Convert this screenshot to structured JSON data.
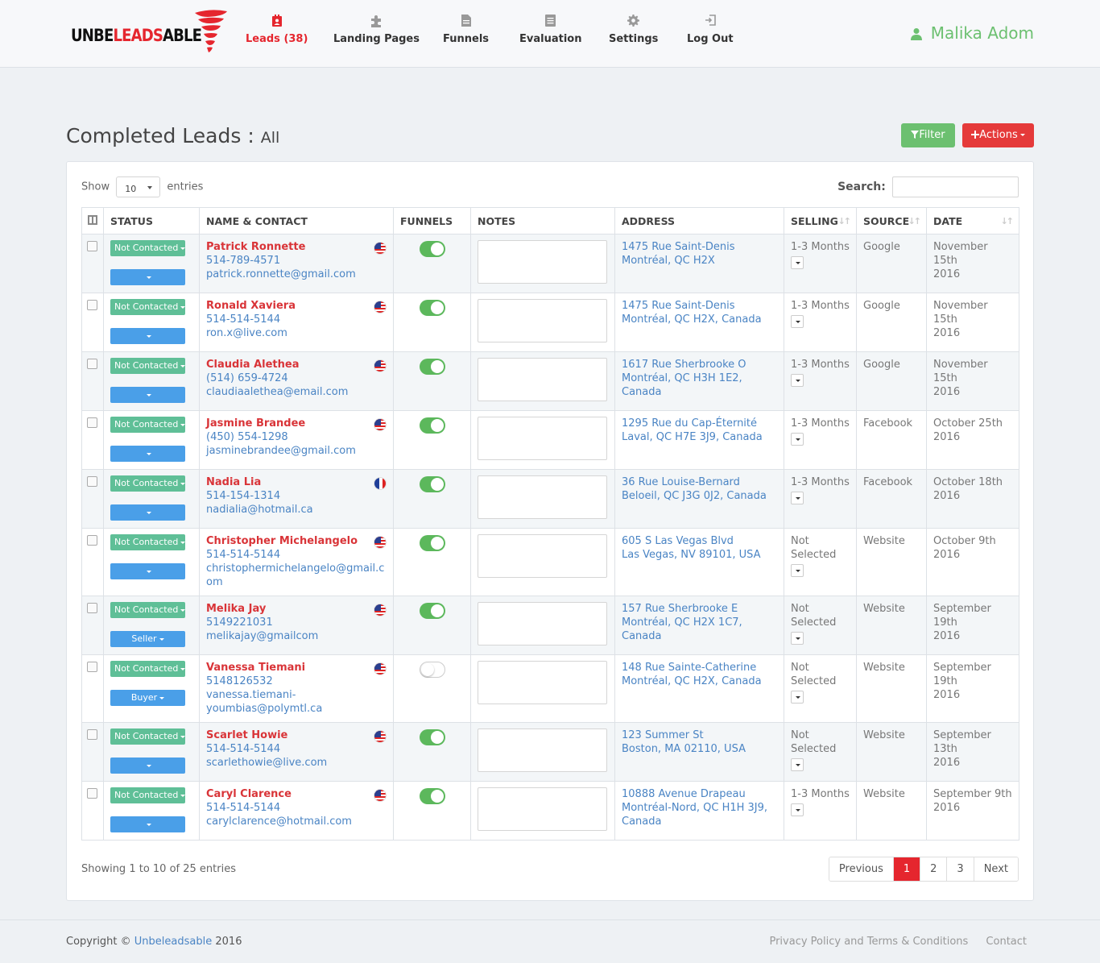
{
  "app": {
    "logo_plain": "UNBE",
    "logo_red": "LEADS",
    "logo_end": "ABLE",
    "colors": {
      "brand_red": "#e5262e",
      "green": "#6cc070",
      "teal": "#5fbf97",
      "blue": "#4a9fe8"
    }
  },
  "nav": {
    "items": [
      {
        "label": "Leads (38)",
        "icon": "contact-card-icon",
        "active": true
      },
      {
        "label": "Landing Pages",
        "icon": "puzzle-icon"
      },
      {
        "label": "Funnels",
        "icon": "document-icon"
      },
      {
        "label": "Evaluation",
        "icon": "list-doc-icon"
      },
      {
        "label": "Settings",
        "icon": "gear-icon"
      },
      {
        "label": "Log Out",
        "icon": "logout-icon"
      }
    ],
    "user_name": "Malika Adom"
  },
  "page": {
    "title": "Completed Leads :",
    "subtitle": "All",
    "filter_label": "Filter",
    "actions_label": "Actions"
  },
  "table_controls": {
    "show_label": "Show",
    "show_value": "10",
    "entries_label": "entries",
    "search_label": "Search:"
  },
  "columns": [
    "STATUS",
    "NAME & CONTACT",
    "FUNNELS",
    "NOTES",
    "ADDRESS",
    "SELLING",
    "SOURCE",
    "DATE"
  ],
  "rows": [
    {
      "status": "Not Contacted",
      "type": "",
      "name": "Patrick Ronnette",
      "phone": "514-789-4571",
      "email": "patrick.ronnette@gmail.com",
      "flag": "us",
      "funnel_on": true,
      "addr1": "1475 Rue Saint-Denis",
      "addr2": "Montréal, QC H2X",
      "selling": "1-3 Months",
      "source": "Google",
      "date1": "November 15th",
      "date2": "2016"
    },
    {
      "status": "Not Contacted",
      "type": "",
      "name": "Ronald Xaviera",
      "phone": "514-514-5144",
      "email": "ron.x@live.com",
      "flag": "us",
      "funnel_on": true,
      "addr1": "1475 Rue Saint-Denis",
      "addr2": "Montréal, QC H2X, Canada",
      "selling": "1-3 Months",
      "source": "Google",
      "date1": "November 15th",
      "date2": "2016"
    },
    {
      "status": "Not Contacted",
      "type": "",
      "name": "Claudia Alethea",
      "phone": "(514) 659-4724",
      "email": "claudiaalethea@email.com",
      "flag": "us",
      "funnel_on": true,
      "addr1": "1617 Rue Sherbrooke O",
      "addr2": "Montréal, QC H3H 1E2, Canada",
      "selling": "1-3 Months",
      "source": "Google",
      "date1": "November 15th",
      "date2": "2016"
    },
    {
      "status": "Not Contacted",
      "type": "",
      "name": "Jasmine Brandee",
      "phone": "(450) 554-1298",
      "email": "jasminebrandee@gmail.com",
      "flag": "us",
      "funnel_on": true,
      "addr1": "1295 Rue du Cap-Éternité",
      "addr2": "Laval, QC H7E 3J9, Canada",
      "selling": "1-3 Months",
      "source": "Facebook",
      "date1": "October 25th",
      "date2": "2016"
    },
    {
      "status": "Not Contacted",
      "type": "",
      "name": "Nadia Lia",
      "phone": "514-154-1314",
      "email": "nadialia@hotmail.ca",
      "flag": "fr",
      "funnel_on": true,
      "addr1": "36 Rue Louise-Bernard",
      "addr2": "Beloeil, QC J3G 0J2, Canada",
      "selling": "1-3 Months",
      "source": "Facebook",
      "date1": "October 18th",
      "date2": "2016"
    },
    {
      "status": "Not Contacted",
      "type": "",
      "name": "Christopher Michelangelo",
      "phone": "514-514-5144",
      "email": "christophermichelangelo@gmail.com",
      "flag": "us",
      "funnel_on": true,
      "addr1": "605 S Las Vegas Blvd",
      "addr2": "Las Vegas, NV 89101, USA",
      "selling": "Not Selected",
      "source": "Website",
      "date1": "October 9th",
      "date2": "2016"
    },
    {
      "status": "Not Contacted",
      "type": "Seller",
      "name": "Melika Jay",
      "phone": "5149221031",
      "email": "melikajay@gmailcom",
      "flag": "us",
      "funnel_on": true,
      "addr1": "157 Rue Sherbrooke E",
      "addr2": "Montréal, QC H2X 1C7, Canada",
      "selling": "Not Selected",
      "source": "Website",
      "date1": "September 19th",
      "date2": "2016"
    },
    {
      "status": "Not Contacted",
      "type": "Buyer",
      "name": "Vanessa Tiemani",
      "phone": "5148126532",
      "email": "vanessa.tiemani-youmbias@polymtl.ca",
      "flag": "us",
      "funnel_on": false,
      "addr1": "148 Rue Sainte-Catherine",
      "addr2": "Montréal, QC H2X, Canada",
      "selling": "Not Selected",
      "source": "Website",
      "date1": "September 19th",
      "date2": "2016"
    },
    {
      "status": "Not Contacted",
      "type": "",
      "name": "Scarlet Howie",
      "phone": "514-514-5144",
      "email": "scarlethowie@live.com",
      "flag": "us",
      "funnel_on": true,
      "addr1": "123 Summer St",
      "addr2": "Boston, MA 02110, USA",
      "selling": "Not Selected",
      "source": "Website",
      "date1": "September 13th",
      "date2": "2016"
    },
    {
      "status": "Not Contacted",
      "type": "",
      "name": "Caryl Clarence",
      "phone": "514-514-5144",
      "email": "carylclarence@hotmail.com",
      "flag": "us",
      "funnel_on": true,
      "addr1": "10888 Avenue Drapeau",
      "addr2": "Montréal-Nord, QC H1H 3J9, Canada",
      "selling": "1-3 Months",
      "source": "Website",
      "date1": "September 9th",
      "date2": "2016"
    }
  ],
  "pagination": {
    "info": "Showing 1 to 10 of 25 entries",
    "previous": "Previous",
    "pages": [
      "1",
      "2",
      "3"
    ],
    "current": "1",
    "next": "Next"
  },
  "footer": {
    "copyright": "Copyright ©",
    "brand": "Unbeleadsable",
    "year": "2016",
    "privacy": "Privacy Policy and Terms & Conditions",
    "contact": "Contact"
  }
}
